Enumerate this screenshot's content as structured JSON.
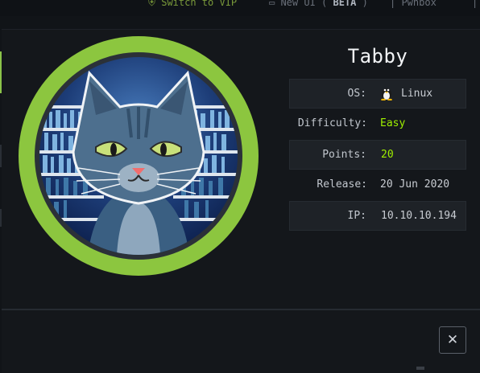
{
  "topbar": {
    "vip_label": "Switch to VIP",
    "newui_label": "New UI",
    "beta_label": "BETA",
    "pwnbox_label": "Pwnbox"
  },
  "machine": {
    "name": "Tabby",
    "avatar_icon": "cat-avatar",
    "ring_color": "#8cc63f",
    "info": [
      {
        "label": "OS:",
        "value": "Linux",
        "icon": "linux-tux-icon"
      },
      {
        "label": "Difficulty:",
        "value": "Easy"
      },
      {
        "label": "Points:",
        "value": "20"
      },
      {
        "label": "Release:",
        "value": "20 Jun 2020"
      },
      {
        "label": "IP:",
        "value": "10.10.10.194"
      }
    ]
  },
  "modal": {
    "close_label": "✕"
  },
  "colors": {
    "accent_green": "#9fef00",
    "background": "#111418"
  }
}
